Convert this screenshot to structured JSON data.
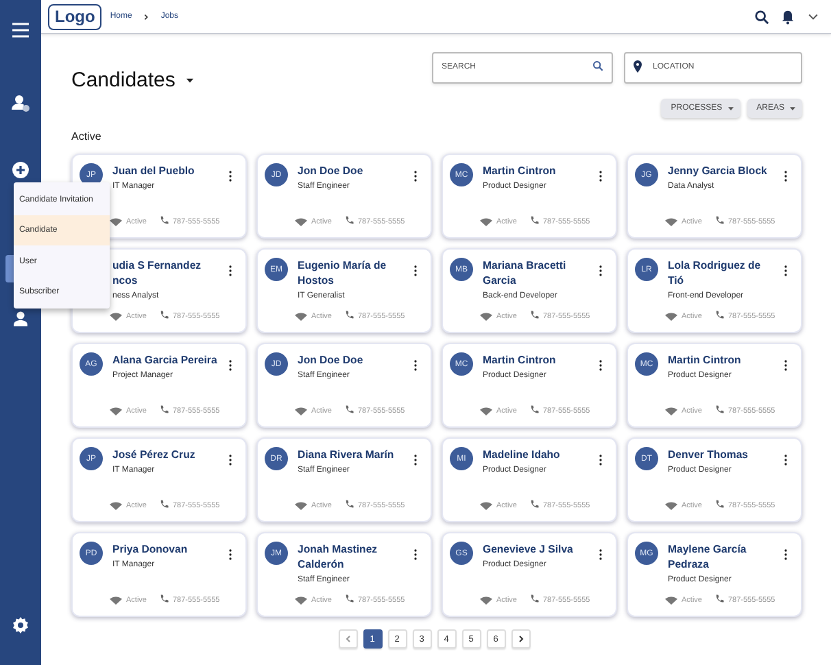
{
  "header": {
    "logo": "Logo",
    "breadcrumb": [
      "Home",
      "Jobs"
    ]
  },
  "page": {
    "title": "Candidates",
    "search": {
      "placeholder": "SEARCH"
    },
    "location": {
      "placeholder": "LOCATION"
    },
    "filters": [
      "PROCESSES",
      "AREAS"
    ],
    "section": "Active"
  },
  "menu": {
    "items": [
      {
        "label": "Candidate Invitation",
        "selected": false
      },
      {
        "label": "Candidate",
        "selected": true
      },
      {
        "label": "User",
        "selected": false
      },
      {
        "label": "Subscriber",
        "selected": false
      }
    ]
  },
  "cards": [
    {
      "initials": "JP",
      "name": "Juan del Pueblo",
      "title": "IT Manager",
      "status": "Active",
      "phone": "787-555-5555"
    },
    {
      "initials": "JD",
      "name": "Jon Doe Doe",
      "title": "Staff Engineer",
      "status": "Active",
      "phone": "787-555-5555"
    },
    {
      "initials": "MC",
      "name": "Martin Cintron",
      "title": "Product Designer",
      "status": "Active",
      "phone": "787-555-5555"
    },
    {
      "initials": "JG",
      "name": "Jenny Garcia Block",
      "title": "Data Analyst",
      "status": "Active",
      "phone": "787-555-5555"
    },
    {
      "name": "udia S Fernandez ncos",
      "title": "ness Analyst",
      "status": "Active",
      "phone": "787-555-5555"
    },
    {
      "initials": "EM",
      "name": "Eugenio María de Hostos",
      "title": "IT Generalist",
      "status": "Active",
      "phone": "787-555-5555"
    },
    {
      "initials": "MB",
      "name": "Mariana Bracetti Garcia",
      "title": "Back-end Developer",
      "status": "Active",
      "phone": "787-555-5555"
    },
    {
      "initials": "LR",
      "name": "Lola Rodriguez de Tió",
      "title": "Front-end Developer",
      "status": "Active",
      "phone": "787-555-5555"
    },
    {
      "initials": "AG",
      "name": "Alana Garcia Pereira",
      "title": "Project Manager",
      "status": "Active",
      "phone": "787-555-5555"
    },
    {
      "initials": "JD",
      "name": "Jon Doe Doe",
      "title": "Staff Engineer",
      "status": "Active",
      "phone": "787-555-5555"
    },
    {
      "initials": "MC",
      "name": "Martin Cintron",
      "title": "Product Designer",
      "status": "Active",
      "phone": "787-555-5555"
    },
    {
      "initials": "MC",
      "name": "Martin Cintron",
      "title": "Product Designer",
      "status": "Active",
      "phone": "787-555-5555"
    },
    {
      "initials": "JP",
      "name": "José Pérez Cruz",
      "title": "IT Manager",
      "status": "Active",
      "phone": "787-555-5555"
    },
    {
      "initials": "DR",
      "name": "Diana Rivera Marín",
      "title": "Staff Engineer",
      "status": "Active",
      "phone": "787-555-5555"
    },
    {
      "initials": "MI",
      "name": "Madeline Idaho",
      "title": "Product Designer",
      "status": "Active",
      "phone": "787-555-5555"
    },
    {
      "initials": "DT",
      "name": "Denver Thomas",
      "title": "Product Designer",
      "status": "Active",
      "phone": "787-555-5555"
    },
    {
      "initials": "PD",
      "name": "Priya Donovan",
      "title": "IT Manager",
      "status": "Active",
      "phone": "787-555-5555"
    },
    {
      "initials": "JM",
      "name": "Jonah Mastinez Calderón",
      "title": "Staff Engineer",
      "status": "Active",
      "phone": "787-555-5555"
    },
    {
      "initials": "GS",
      "name": "Genevieve J Silva",
      "title": "Product Designer",
      "status": "Active",
      "phone": "787-555-5555"
    },
    {
      "initials": "MG",
      "name": "Maylene García Pedraza",
      "title": "Product Designer",
      "status": "Active",
      "phone": "787-555-5555"
    }
  ],
  "pagination": [
    {
      "label": "1",
      "selected": true
    },
    {
      "label": "2",
      "selected": false
    },
    {
      "label": "3",
      "selected": false
    },
    {
      "label": "4",
      "selected": false
    },
    {
      "label": "5",
      "selected": false
    },
    {
      "label": "6",
      "selected": false
    }
  ]
}
